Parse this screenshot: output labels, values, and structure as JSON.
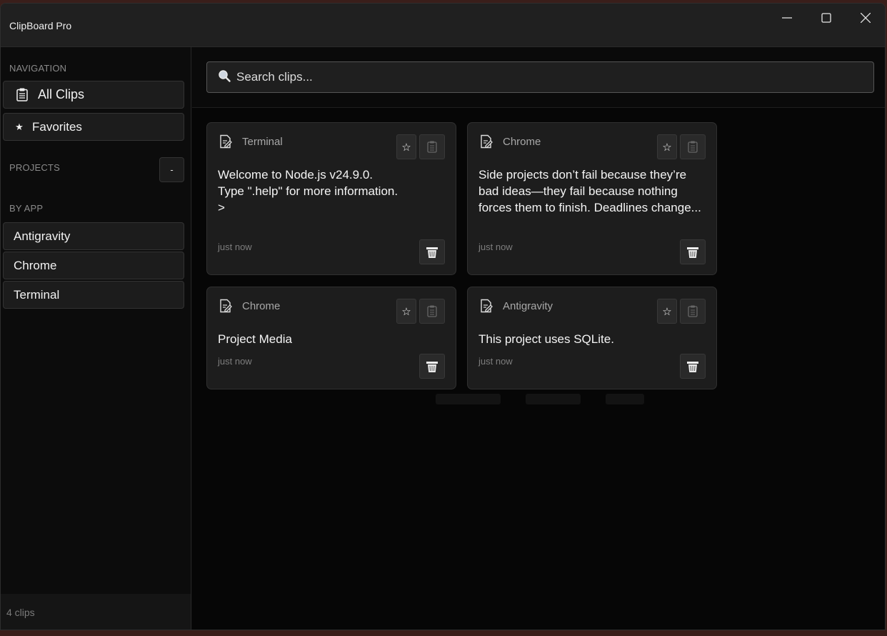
{
  "window": {
    "title": "ClipBoard Pro"
  },
  "sidebar": {
    "navigation_label": "NAVIGATION",
    "nav_items": [
      {
        "label": "All Clips",
        "icon": "clipboard-icon"
      },
      {
        "label": "Favorites",
        "icon": "star-icon"
      }
    ],
    "projects_label": "PROJECTS",
    "projects_button": "-",
    "by_app_label": "BY APP",
    "apps": [
      "Antigravity",
      "Chrome",
      "Terminal"
    ],
    "footer": "4 clips"
  },
  "search": {
    "placeholder": "Search clips...",
    "value": ""
  },
  "clips": [
    {
      "app": "Terminal",
      "content": "Welcome to Node.js v24.9.0.\nType \".help\" for more information.\n>",
      "time": "just now"
    },
    {
      "app": "Chrome",
      "content": "Side projects don’t fail because they’re bad ideas—they fail because nothing forces them to finish. Deadlines change...",
      "time": "just now"
    },
    {
      "app": "Chrome",
      "content": "Project Media",
      "time": "just now"
    },
    {
      "app": "Antigravity",
      "content": "This project uses SQLite.",
      "time": "just now"
    }
  ],
  "colors": {
    "background": "#060606",
    "card": "#1d1d1d",
    "accent": "#f2f2f2"
  }
}
